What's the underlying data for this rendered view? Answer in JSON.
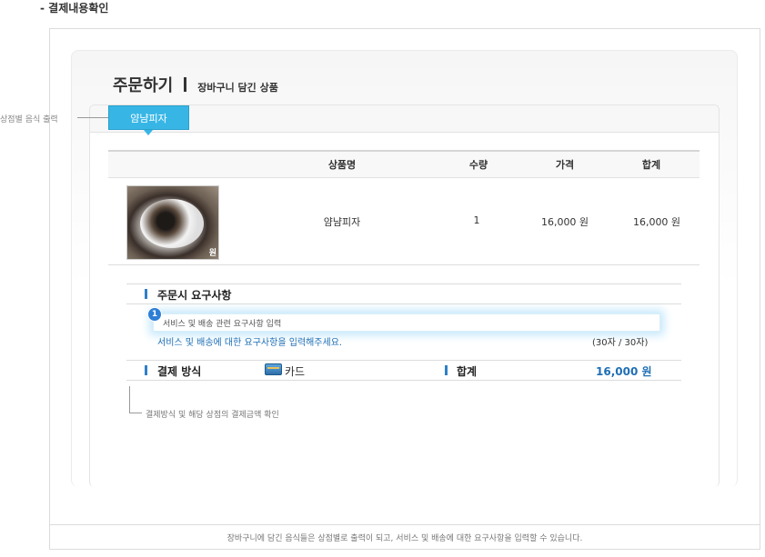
{
  "section_title": "- 결제내용확인",
  "header": {
    "title": "주문하기",
    "subtitle": "장바구니 담긴 상품"
  },
  "side_annotation": "상점별 음식 출력",
  "store_tab": "얌냠피자",
  "table": {
    "headers": [
      "상품명",
      "수량",
      "가격",
      "합계"
    ],
    "rows": [
      {
        "thumb_mark": "원",
        "name": "얌냠피자",
        "qty": "1",
        "price": "16,000 원",
        "total": "16,000 원"
      }
    ]
  },
  "request": {
    "title": "주문시 요구사항",
    "badge": "1",
    "input_value": "서비스 및 배송 관련 요구사항 입력",
    "hint": "서비스 및 배송에 대한 요구사항을 입력해주세요.",
    "count": "(30자 / 30자)"
  },
  "payment": {
    "title": "결제 방식",
    "method_icon": "credit-card-icon",
    "method": "카드",
    "sum_title": "합계",
    "sum_value": "16,000 원"
  },
  "payment_note": "결제방식 및 해당 상점의 결제금액 확인",
  "footer_note": "장바구니에 담긴 음식들은 상점별로 출력이 되고, 서비스 및 배송에 대한 요구사항을 입력할 수 있습니다.",
  "colors": {
    "tab": "#37b6e6",
    "accent": "#1f6fb5",
    "bullet": "#2f80c7"
  }
}
